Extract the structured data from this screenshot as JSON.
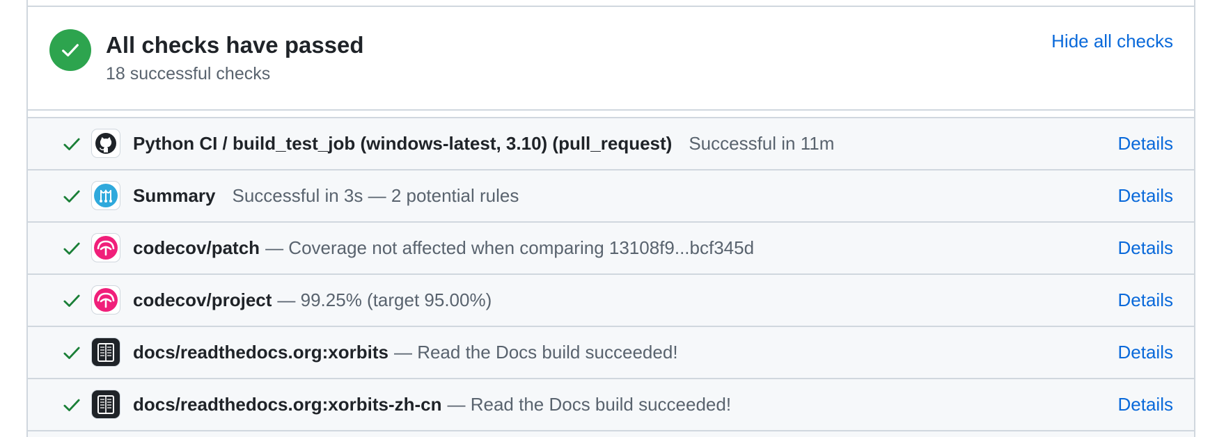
{
  "summary": {
    "title": "All checks have passed",
    "subtitle": "18 successful checks",
    "hide_label": "Hide all checks"
  },
  "colors": {
    "success": "#2da44e",
    "link": "#0969da",
    "codecov": "#f01f7a",
    "mergify": "#2fa9dc"
  },
  "checks": [
    {
      "icon": "github-icon",
      "name": "Python CI / build_test_job (windows-latest, 3.10) (pull_request)",
      "desc": "Successful in 11m",
      "details": "Details"
    },
    {
      "icon": "mergify-icon",
      "name": "Summary",
      "desc": "Successful in 3s — 2 potential rules",
      "details": "Details"
    },
    {
      "icon": "codecov-icon",
      "name": "codecov/patch",
      "desc": "— Coverage not affected when comparing 13108f9...bcf345d",
      "details": "Details"
    },
    {
      "icon": "codecov-icon",
      "name": "codecov/project",
      "desc": "— 99.25% (target 95.00%)",
      "details": "Details"
    },
    {
      "icon": "readthedocs-icon",
      "name": "docs/readthedocs.org:xorbits",
      "desc": "— Read the Docs build succeeded!",
      "details": "Details"
    },
    {
      "icon": "readthedocs-icon",
      "name": "docs/readthedocs.org:xorbits-zh-cn",
      "desc": "— Read the Docs build succeeded!",
      "details": "Details"
    }
  ]
}
